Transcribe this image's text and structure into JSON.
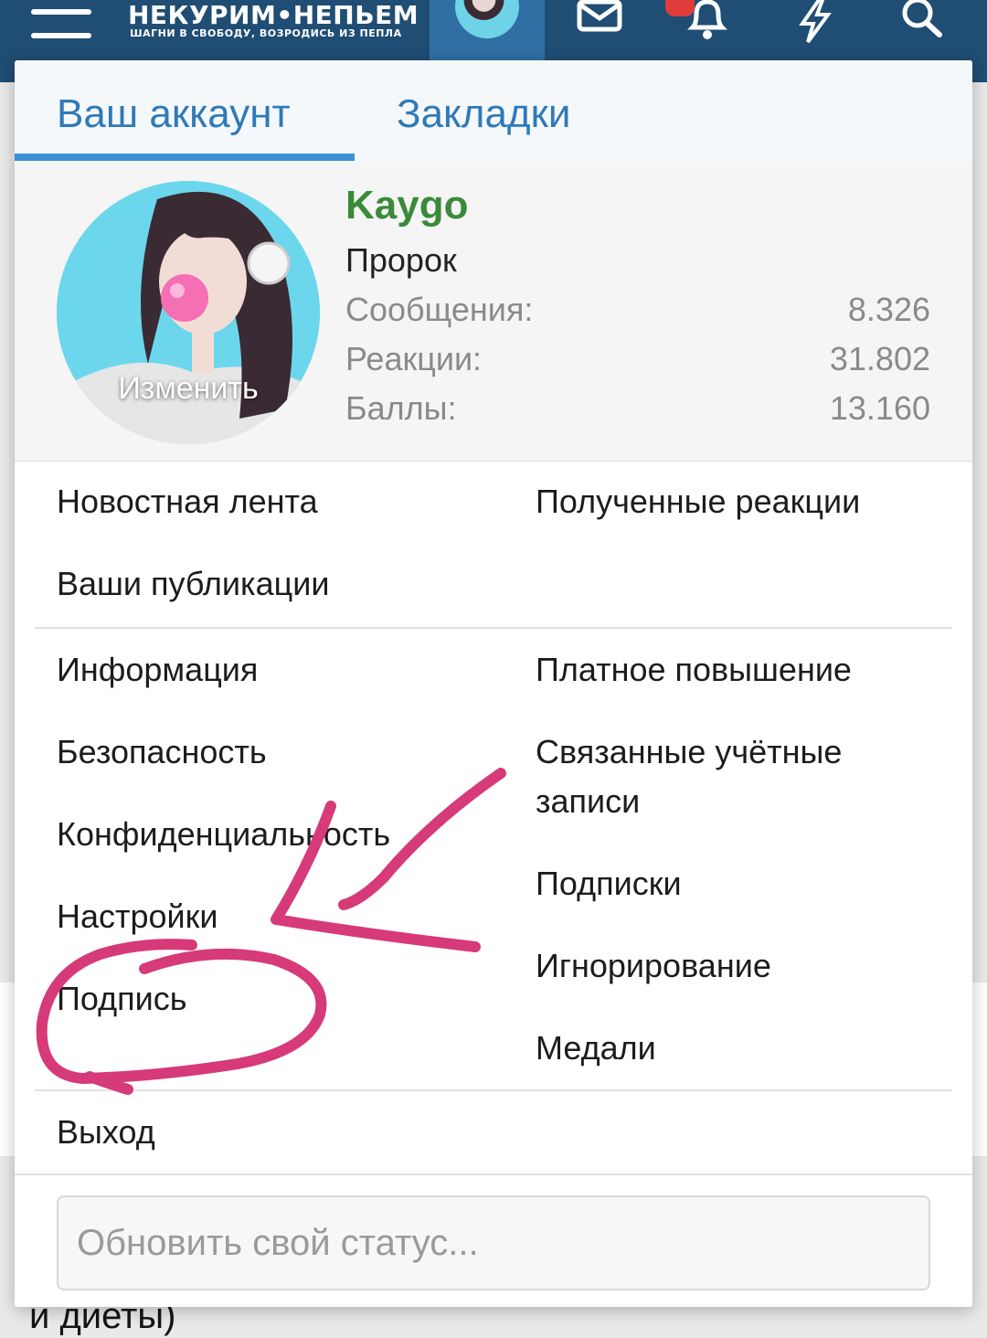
{
  "header": {
    "logo_main": "НЕКУРИМ•НЕПЬЕМ",
    "logo_sub": "ШАГНИ В СВОБОДУ, ВОЗРОДИСЬ ИЗ ПЕПЛА",
    "icons": [
      "menu-icon",
      "avatar",
      "mail-icon",
      "bell-icon",
      "lightning-icon",
      "search-icon"
    ],
    "accent_color": "#1f4d73",
    "badge_color": "#e03b3b"
  },
  "popup": {
    "tabs": [
      {
        "label": "Ваш аккаунт",
        "active": true
      },
      {
        "label": "Закладки",
        "active": false
      }
    ],
    "profile": {
      "change_label": "Изменить",
      "username": "Kaygo",
      "user_title": "Пророк",
      "stats": [
        {
          "label": "Сообщения:",
          "value": "8.326"
        },
        {
          "label": "Реакции:",
          "value": "31.802"
        },
        {
          "label": "Баллы:",
          "value": "13.160"
        }
      ]
    },
    "links_group1": {
      "left": [
        "Новостная лента",
        "Ваши публикации"
      ],
      "right": [
        "Полученные реакции"
      ]
    },
    "links_group2": {
      "left": [
        "Информация",
        "Безопасность",
        "Конфиденциальность",
        "Настройки",
        "Подпись"
      ],
      "right": [
        "Платное повышение",
        "Связанные учётные",
        "записи",
        "Подписки",
        "Игнорирование",
        "Медали"
      ]
    },
    "logout_label": "Выход",
    "status_placeholder": "Обновить свой статус..."
  },
  "background": {
    "visible_text": "и диеты)"
  },
  "annotation_color": "#d63a78"
}
